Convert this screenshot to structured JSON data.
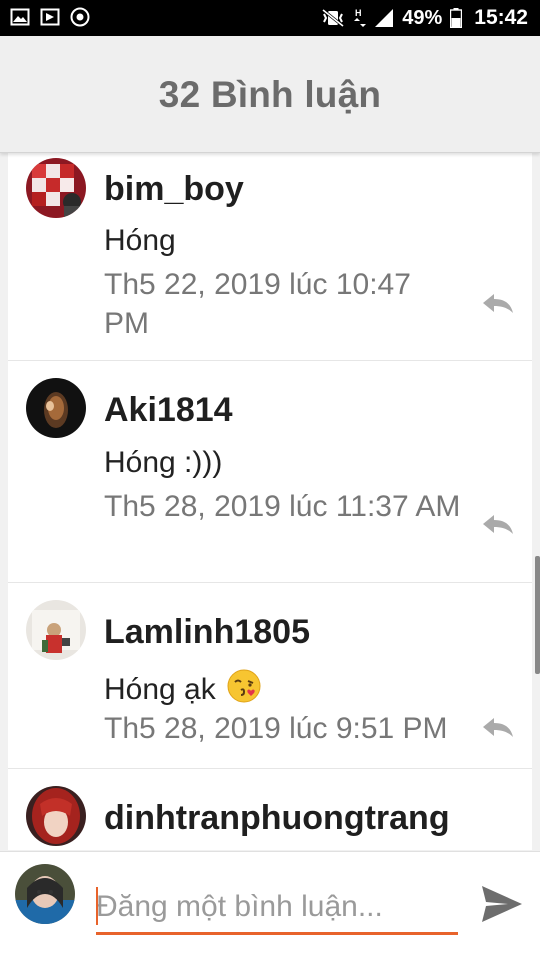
{
  "status_bar": {
    "battery": "49%",
    "time": "15:42",
    "left_icons": [
      "gallery-icon",
      "app-notification-icon",
      "browser-icon"
    ],
    "right_icons": [
      "vibrate-mute-icon",
      "data-transfer-icon",
      "signal-icon",
      "battery-icon"
    ]
  },
  "header": {
    "title": "32 Bình luận"
  },
  "comments": [
    {
      "author": "bim_boy",
      "text": "Hóng",
      "timestamp": "Th5 22, 2019 lúc 10:47 PM"
    },
    {
      "author": "Aki1814",
      "text": "Hóng :)))",
      "timestamp": "Th5 28, 2019 lúc 11:37 AM"
    },
    {
      "author": "Lamlinh1805",
      "text": "Hóng ạk",
      "emoji": "kissing-face-emoji",
      "timestamp": "Th5 28, 2019 lúc 9:51 PM"
    },
    {
      "author": "dinhtranphuongtrang",
      "text": "",
      "timestamp": ""
    }
  ],
  "composer": {
    "placeholder": "Đăng một bình luận...",
    "value": ""
  },
  "colors": {
    "accent": "#e8632b",
    "header_bg": "#efefef",
    "title_text": "#6b6b6b",
    "timestamp_text": "#777777"
  }
}
